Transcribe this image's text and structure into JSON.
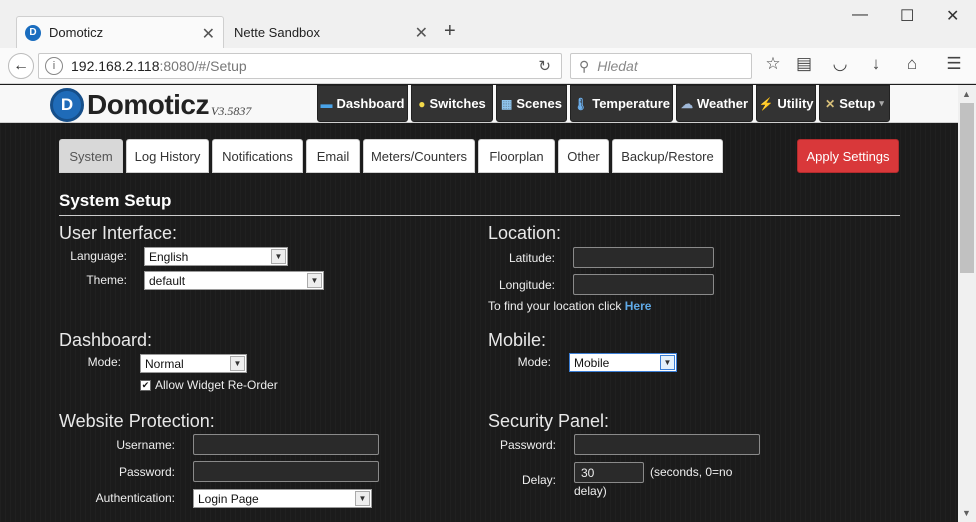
{
  "browser": {
    "tabs": [
      {
        "title": "Domoticz",
        "favicon": "D"
      },
      {
        "title": "Nette Sandbox"
      }
    ],
    "new_tab_symbol": "+",
    "url_host": "192.168.2.118",
    "url_path": ":8080/#/Setup",
    "search_placeholder": "Hledat"
  },
  "app": {
    "logo_mark": "D",
    "name": "Domoticz",
    "version": "V3.5837",
    "nav": [
      {
        "label": "Dashboard",
        "icon": "dashboard-icon"
      },
      {
        "label": "Switches",
        "icon": "bulb-icon"
      },
      {
        "label": "Scenes",
        "icon": "scenes-icon"
      },
      {
        "label": "Temperature",
        "icon": "thermometer-icon"
      },
      {
        "label": "Weather",
        "icon": "weather-icon"
      },
      {
        "label": "Utility",
        "icon": "utility-icon"
      },
      {
        "label": "Setup",
        "icon": "tools-icon",
        "caret": "▾"
      }
    ]
  },
  "subtabs": [
    "System",
    "Log History",
    "Notifications",
    "Email",
    "Meters/Counters",
    "Floorplan",
    "Other",
    "Backup/Restore"
  ],
  "apply_label": "Apply Settings",
  "section_title": "System Setup",
  "user_interface": {
    "heading": "User Interface:",
    "language_label": "Language:",
    "language_value": "English",
    "theme_label": "Theme:",
    "theme_value": "default"
  },
  "location": {
    "heading": "Location:",
    "latitude_label": "Latitude:",
    "latitude_value": "",
    "longitude_label": "Longitude:",
    "longitude_value": "",
    "find_text": "To find your location click ",
    "find_link": "Here"
  },
  "dashboard": {
    "heading": "Dashboard:",
    "mode_label": "Mode:",
    "mode_value": "Normal",
    "reorder_label": "Allow Widget Re-Order",
    "reorder_checked": true
  },
  "mobile": {
    "heading": "Mobile:",
    "mode_label": "Mode:",
    "mode_value": "Mobile"
  },
  "website_protection": {
    "heading": "Website Protection:",
    "username_label": "Username:",
    "username_value": "",
    "password_label": "Password:",
    "password_value": "",
    "auth_label": "Authentication:",
    "auth_value": "Login Page"
  },
  "security_panel": {
    "heading": "Security Panel:",
    "password_label": "Password:",
    "password_value": "",
    "delay_label": "Delay:",
    "delay_value": "30",
    "delay_hint_1": "(seconds, 0=no",
    "delay_hint_2": "delay)"
  },
  "colors": {
    "accent_red": "#d9383a",
    "link_blue": "#5fa9e6",
    "nav_bg": "#333333"
  }
}
